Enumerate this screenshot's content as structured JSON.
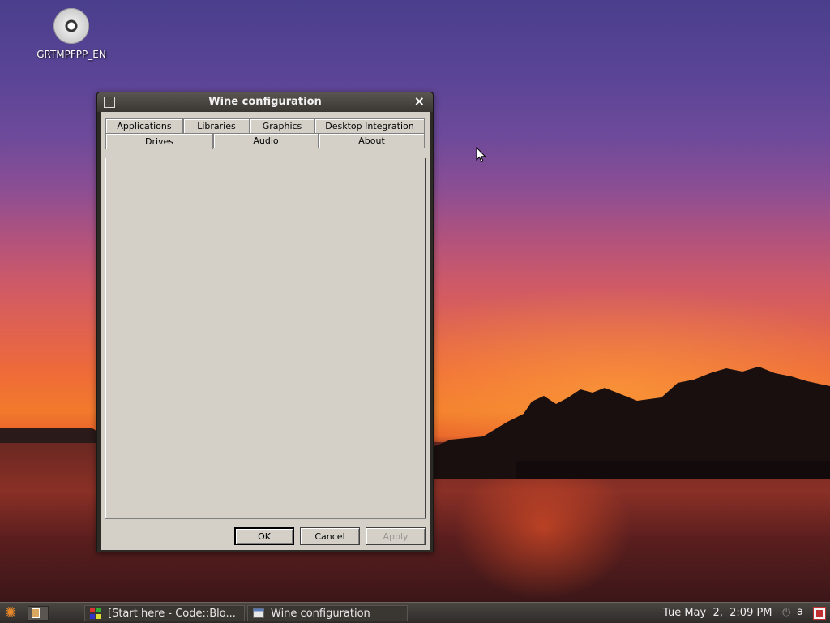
{
  "desktop": {
    "icons": [
      {
        "label": "GRTMPFPP_EN",
        "icon": "cd-disc-icon"
      }
    ]
  },
  "window": {
    "title": "Wine configuration",
    "tabs_row1": [
      "Applications",
      "Libraries",
      "Graphics",
      "Desktop Integration"
    ],
    "tabs_row2": [
      "Drives",
      "Audio",
      "About"
    ],
    "active_tab": "Drives",
    "buttons": {
      "ok": "OK",
      "cancel": "Cancel",
      "apply": "Apply"
    }
  },
  "taskbar": {
    "tasks": [
      {
        "label": "[Start here - Code::Blo...",
        "icon": "codeblocks-icon"
      },
      {
        "label": "Wine configuration",
        "icon": "window-icon"
      }
    ],
    "clock": "Tue May  2,  2:09 PM",
    "user": "a"
  },
  "colors": {
    "dialog_bg": "#d4d0c8",
    "taskbar_bg": "#3a3632",
    "accent_orange": "#e8892a"
  }
}
